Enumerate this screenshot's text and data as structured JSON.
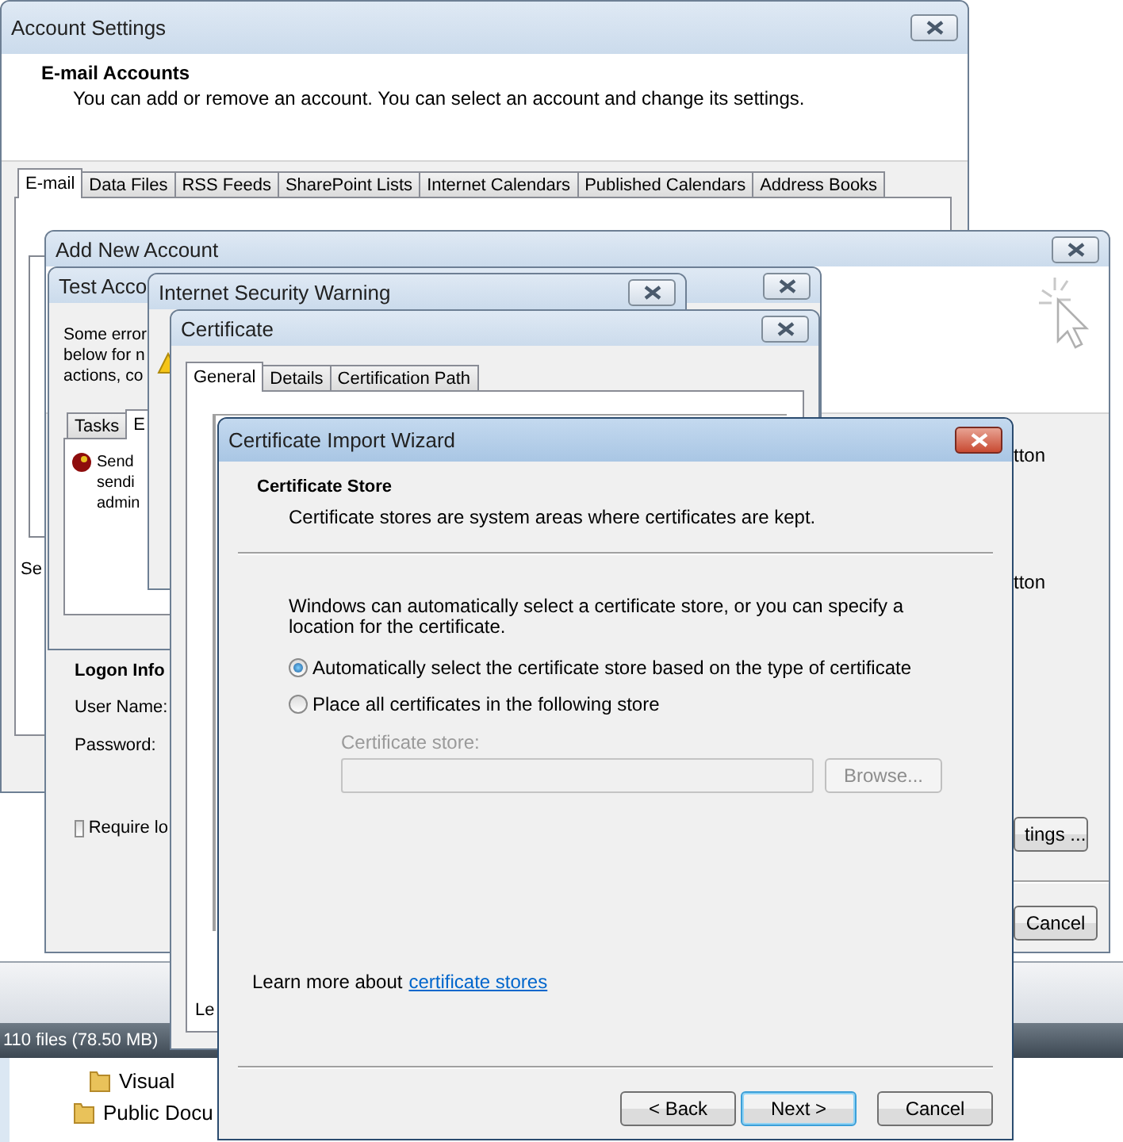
{
  "explorer": {
    "status_text": "110 files (78.50 MB)",
    "folders": [
      {
        "name": "Visual"
      },
      {
        "name": "Public Docu"
      }
    ]
  },
  "account_settings": {
    "title": "Account Settings",
    "heading": "E-mail Accounts",
    "description": "You can add or remove an account. You can select an account and change its settings.",
    "tabs": [
      {
        "label": "E-mail",
        "selected": true
      },
      {
        "label": "Data Files",
        "selected": false
      },
      {
        "label": "RSS Feeds",
        "selected": false
      },
      {
        "label": "SharePoint Lists",
        "selected": false
      },
      {
        "label": "Internet Calendars",
        "selected": false
      },
      {
        "label": "Published Calendars",
        "selected": false
      },
      {
        "label": "Address Books",
        "selected": false
      }
    ],
    "cut_text": "Se"
  },
  "add_new_account": {
    "title": "Add New Account",
    "logon_heading": "Logon Info",
    "user_name_label": "User Name:",
    "password_label": "Password:",
    "require_checkbox": {
      "label": "Require lo",
      "checked": false
    },
    "right_texts": [
      "tton",
      "tton"
    ],
    "settings_button": "tings ...",
    "cancel_button": "Cancel"
  },
  "test_account_settings": {
    "title": "Test Acco",
    "message_lines": [
      "Some error",
      "below for n",
      "actions, co"
    ],
    "tabs": [
      {
        "label": "Tasks",
        "selected": false
      },
      {
        "label": "E",
        "selected": true
      }
    ],
    "tasks": [
      {
        "kind": "error",
        "lines": [
          "Send",
          "sendi",
          "admin"
        ]
      }
    ]
  },
  "internet_security_warning": {
    "title": "Internet Security Warning"
  },
  "certificate": {
    "title": "Certificate",
    "tabs": [
      {
        "label": "General",
        "selected": true
      },
      {
        "label": "Details",
        "selected": false
      },
      {
        "label": "Certification Path",
        "selected": false
      }
    ],
    "cut_text": "Le"
  },
  "certificate_import_wizard": {
    "title": "Certificate Import Wizard",
    "section_title": "Certificate Store",
    "section_subtitle": "Certificate stores are system areas where certificates are kept.",
    "intro": "Windows can automatically select a certificate store, or you can specify a location for the certificate.",
    "options": [
      {
        "label": "Automatically select the certificate store based on the type of certificate",
        "selected": true
      },
      {
        "label": "Place all certificates in the following store",
        "selected": false
      }
    ],
    "store_field": {
      "label": "Certificate store:",
      "disabled": true
    },
    "browse_button": {
      "label": "Browse...",
      "disabled": true
    },
    "learn_more": {
      "text": "Learn more about",
      "link": "certificate stores"
    },
    "buttons": [
      {
        "label": "< Back",
        "default": false
      },
      {
        "label": "Next >",
        "default": true
      },
      {
        "label": "Cancel",
        "default": false
      }
    ]
  }
}
